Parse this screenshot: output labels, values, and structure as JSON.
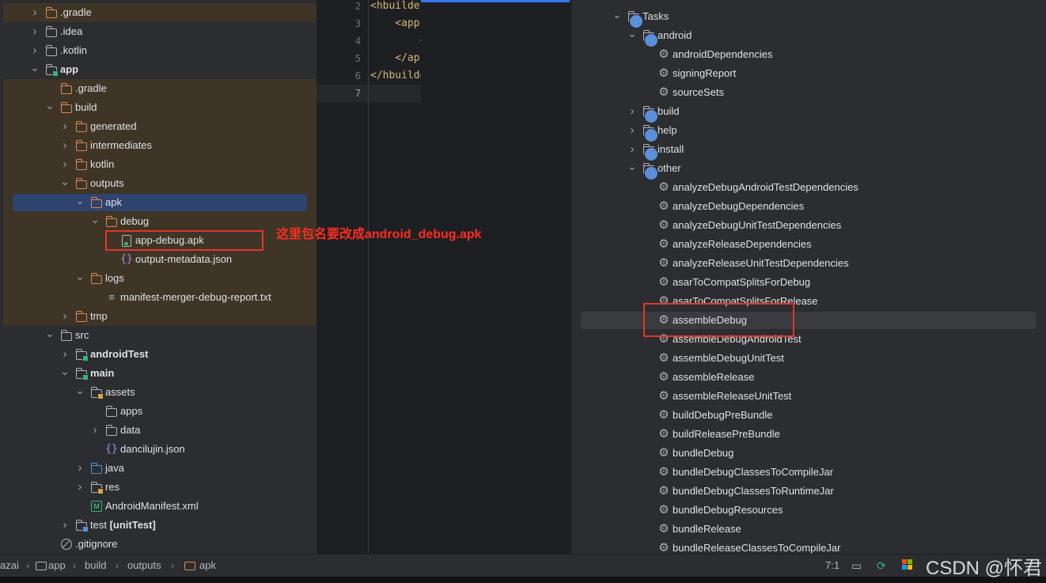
{
  "project_tree": {
    "items": [
      {
        "label": ".gradle",
        "depth": 1,
        "chevron": "right",
        "icon": "folder-orange-icon",
        "bold": false
      },
      {
        "label": ".idea",
        "depth": 1,
        "chevron": "right",
        "icon": "folder-icon",
        "bold": false
      },
      {
        "label": ".kotlin",
        "depth": 1,
        "chevron": "right",
        "icon": "folder-icon",
        "bold": false
      },
      {
        "label": "app",
        "depth": 1,
        "chevron": "down",
        "icon": "module-folder-icon",
        "bold": true
      },
      {
        "label": ".gradle",
        "depth": 2,
        "chevron": "",
        "icon": "folder-orange-icon",
        "bold": false
      },
      {
        "label": "build",
        "depth": 2,
        "chevron": "down",
        "icon": "folder-orange-icon",
        "bold": false
      },
      {
        "label": "generated",
        "depth": 3,
        "chevron": "right",
        "icon": "folder-orange-icon",
        "bold": false
      },
      {
        "label": "intermediates",
        "depth": 3,
        "chevron": "right",
        "icon": "folder-orange-icon",
        "bold": false
      },
      {
        "label": "kotlin",
        "depth": 3,
        "chevron": "right",
        "icon": "folder-orange-icon",
        "bold": false
      },
      {
        "label": "outputs",
        "depth": 3,
        "chevron": "down",
        "icon": "folder-orange-icon",
        "bold": false
      },
      {
        "label": "apk",
        "depth": 4,
        "chevron": "down",
        "icon": "folder-orange-icon",
        "bold": false,
        "selected": true
      },
      {
        "label": "debug",
        "depth": 5,
        "chevron": "down",
        "icon": "folder-orange-icon",
        "bold": false
      },
      {
        "label": "app-debug.apk",
        "depth": 6,
        "chevron": "",
        "icon": "apk-file-icon",
        "bold": false
      },
      {
        "label": "output-metadata.json",
        "depth": 6,
        "chevron": "",
        "icon": "json-file-icon",
        "bold": false
      },
      {
        "label": "logs",
        "depth": 4,
        "chevron": "down",
        "icon": "folder-orange-icon",
        "bold": false
      },
      {
        "label": "manifest-merger-debug-report.txt",
        "depth": 5,
        "chevron": "",
        "icon": "text-file-icon",
        "bold": false
      },
      {
        "label": "tmp",
        "depth": 3,
        "chevron": "right",
        "icon": "folder-orange-icon",
        "bold": false
      },
      {
        "label": "src",
        "depth": 2,
        "chevron": "down",
        "icon": "folder-icon",
        "bold": false
      },
      {
        "label": "androidTest",
        "depth": 3,
        "chevron": "right",
        "icon": "source-folder-icon",
        "bold": true
      },
      {
        "label": "main",
        "depth": 3,
        "chevron": "down",
        "icon": "source-folder-icon",
        "bold": true
      },
      {
        "label": "assets",
        "depth": 4,
        "chevron": "down",
        "icon": "resource-folder-icon",
        "bold": false
      },
      {
        "label": "apps",
        "depth": 5,
        "chevron": "",
        "icon": "folder-icon",
        "bold": false
      },
      {
        "label": "data",
        "depth": 5,
        "chevron": "right",
        "icon": "folder-icon",
        "bold": false
      },
      {
        "label": "dancilujin.json",
        "depth": 5,
        "chevron": "",
        "icon": "json-file-icon",
        "bold": false
      },
      {
        "label": "java",
        "depth": 4,
        "chevron": "right",
        "icon": "folder-blue-icon",
        "bold": false
      },
      {
        "label": "res",
        "depth": 4,
        "chevron": "right",
        "icon": "resource-folder-icon",
        "bold": false
      },
      {
        "label": "AndroidManifest.xml",
        "depth": 4,
        "chevron": "",
        "icon": "manifest-file-icon",
        "bold": false
      },
      {
        "label": "test [unitTest]",
        "depth": 3,
        "chevron": "right",
        "icon": "test-folder-icon",
        "bold": false,
        "suffix_bold": true
      },
      {
        "label": ".gitignore",
        "depth": 2,
        "chevron": "",
        "icon": "gitignore-icon",
        "bold": false
      }
    ]
  },
  "editor": {
    "lines": [
      {
        "num": "2",
        "text": "<hbuilde"
      },
      {
        "num": "3",
        "text": "    <app"
      },
      {
        "num": "4",
        "text": "        <"
      },
      {
        "num": "5",
        "text": "    </ap"
      },
      {
        "num": "6",
        "text": "</hbuilde"
      },
      {
        "num": "7",
        "text": ""
      }
    ]
  },
  "gradle_tasks": {
    "items": [
      {
        "label": "Tasks",
        "depth": 0,
        "chevron": "down",
        "icon": "task-folder-icon"
      },
      {
        "label": "android",
        "depth": 1,
        "chevron": "down",
        "icon": "task-folder-icon"
      },
      {
        "label": "androidDependencies",
        "depth": 2,
        "chevron": "",
        "icon": "gear-icon"
      },
      {
        "label": "signingReport",
        "depth": 2,
        "chevron": "",
        "icon": "gear-icon"
      },
      {
        "label": "sourceSets",
        "depth": 2,
        "chevron": "",
        "icon": "gear-icon"
      },
      {
        "label": "build",
        "depth": 1,
        "chevron": "right",
        "icon": "task-folder-icon"
      },
      {
        "label": "help",
        "depth": 1,
        "chevron": "right",
        "icon": "task-folder-icon"
      },
      {
        "label": "install",
        "depth": 1,
        "chevron": "right",
        "icon": "task-folder-icon"
      },
      {
        "label": "other",
        "depth": 1,
        "chevron": "down",
        "icon": "task-folder-icon"
      },
      {
        "label": "analyzeDebugAndroidTestDependencies",
        "depth": 2,
        "chevron": "",
        "icon": "gear-icon"
      },
      {
        "label": "analyzeDebugDependencies",
        "depth": 2,
        "chevron": "",
        "icon": "gear-icon"
      },
      {
        "label": "analyzeDebugUnitTestDependencies",
        "depth": 2,
        "chevron": "",
        "icon": "gear-icon"
      },
      {
        "label": "analyzeReleaseDependencies",
        "depth": 2,
        "chevron": "",
        "icon": "gear-icon"
      },
      {
        "label": "analyzeReleaseUnitTestDependencies",
        "depth": 2,
        "chevron": "",
        "icon": "gear-icon"
      },
      {
        "label": "asarToCompatSplitsForDebug",
        "depth": 2,
        "chevron": "",
        "icon": "gear-icon"
      },
      {
        "label": "asarToCompatSplitsForRelease",
        "depth": 2,
        "chevron": "",
        "icon": "gear-icon"
      },
      {
        "label": "assembleDebug",
        "depth": 2,
        "chevron": "",
        "icon": "gear-icon",
        "selected": true
      },
      {
        "label": "assembleDebugAndroidTest",
        "depth": 2,
        "chevron": "",
        "icon": "gear-icon"
      },
      {
        "label": "assembleDebugUnitTest",
        "depth": 2,
        "chevron": "",
        "icon": "gear-icon"
      },
      {
        "label": "assembleRelease",
        "depth": 2,
        "chevron": "",
        "icon": "gear-icon"
      },
      {
        "label": "assembleReleaseUnitTest",
        "depth": 2,
        "chevron": "",
        "icon": "gear-icon"
      },
      {
        "label": "buildDebugPreBundle",
        "depth": 2,
        "chevron": "",
        "icon": "gear-icon"
      },
      {
        "label": "buildReleasePreBundle",
        "depth": 2,
        "chevron": "",
        "icon": "gear-icon"
      },
      {
        "label": "bundleDebug",
        "depth": 2,
        "chevron": "",
        "icon": "gear-icon"
      },
      {
        "label": "bundleDebugClassesToCompileJar",
        "depth": 2,
        "chevron": "",
        "icon": "gear-icon"
      },
      {
        "label": "bundleDebugClassesToRuntimeJar",
        "depth": 2,
        "chevron": "",
        "icon": "gear-icon"
      },
      {
        "label": "bundleDebugResources",
        "depth": 2,
        "chevron": "",
        "icon": "gear-icon"
      },
      {
        "label": "bundleRelease",
        "depth": 2,
        "chevron": "",
        "icon": "gear-icon"
      },
      {
        "label": "bundleReleaseClassesToCompileJar",
        "depth": 2,
        "chevron": "",
        "icon": "gear-icon"
      }
    ]
  },
  "annotation": {
    "text": "这里包名要改成android_debug.apk",
    "color": "#e5352b"
  },
  "statusbar": {
    "breadcrumbs": [
      "azai",
      "app",
      "build",
      "outputs",
      "apk"
    ],
    "cursor_position": "7:1"
  },
  "watermark": "CSDN @怀君",
  "colors": {
    "accent": "#3574f0",
    "excluded_band": "#3e3526",
    "selection_blue": "#2e436e",
    "selection_gray": "#393b40"
  }
}
